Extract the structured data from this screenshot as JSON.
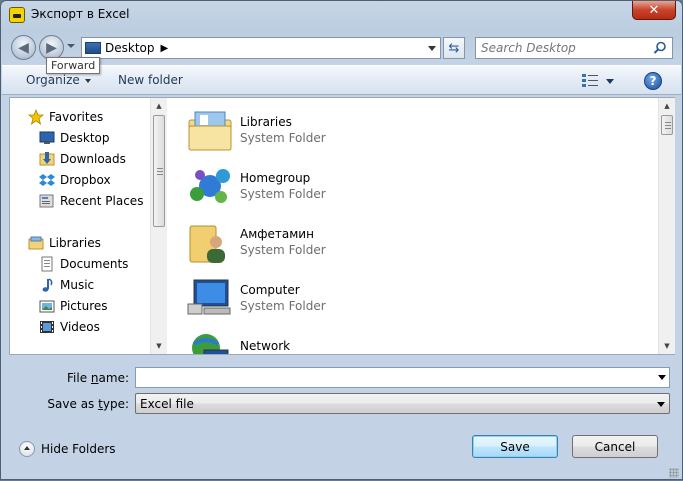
{
  "window": {
    "title": "Экспорт в Excel",
    "close_label": "✕"
  },
  "navbar": {
    "tooltip": "Forward",
    "address": "Desktop",
    "address_arrow": "▶",
    "search_placeholder": "Search Desktop"
  },
  "toolbar": {
    "organize": "Organize",
    "new_folder": "New folder",
    "help": "?"
  },
  "sidebar": {
    "favorites_header": "Favorites",
    "favorites": [
      {
        "label": "Desktop"
      },
      {
        "label": "Downloads"
      },
      {
        "label": "Dropbox"
      },
      {
        "label": "Recent Places"
      }
    ],
    "libraries_header": "Libraries",
    "libraries": [
      {
        "label": "Documents"
      },
      {
        "label": "Music"
      },
      {
        "label": "Pictures"
      },
      {
        "label": "Videos"
      }
    ]
  },
  "files": [
    {
      "name": "Libraries",
      "type": "System Folder",
      "icon": "libraries-icon"
    },
    {
      "name": "Homegroup",
      "type": "System Folder",
      "icon": "homegroup-icon"
    },
    {
      "name": "Амфетамин",
      "type": "System Folder",
      "icon": "user-folder-icon"
    },
    {
      "name": "Computer",
      "type": "System Folder",
      "icon": "computer-icon"
    },
    {
      "name": "Network",
      "type": "",
      "icon": "network-icon"
    }
  ],
  "bottom": {
    "file_name_label_pre": "File ",
    "file_name_label_u": "n",
    "file_name_label_post": "ame:",
    "file_name_value": "",
    "save_type_label_pre": "Save as ",
    "save_type_label_u": "t",
    "save_type_label_post": "ype:",
    "save_type_value": "Excel file",
    "hide_folders": "Hide Folders",
    "save_button": "Save",
    "cancel_button": "Cancel"
  }
}
